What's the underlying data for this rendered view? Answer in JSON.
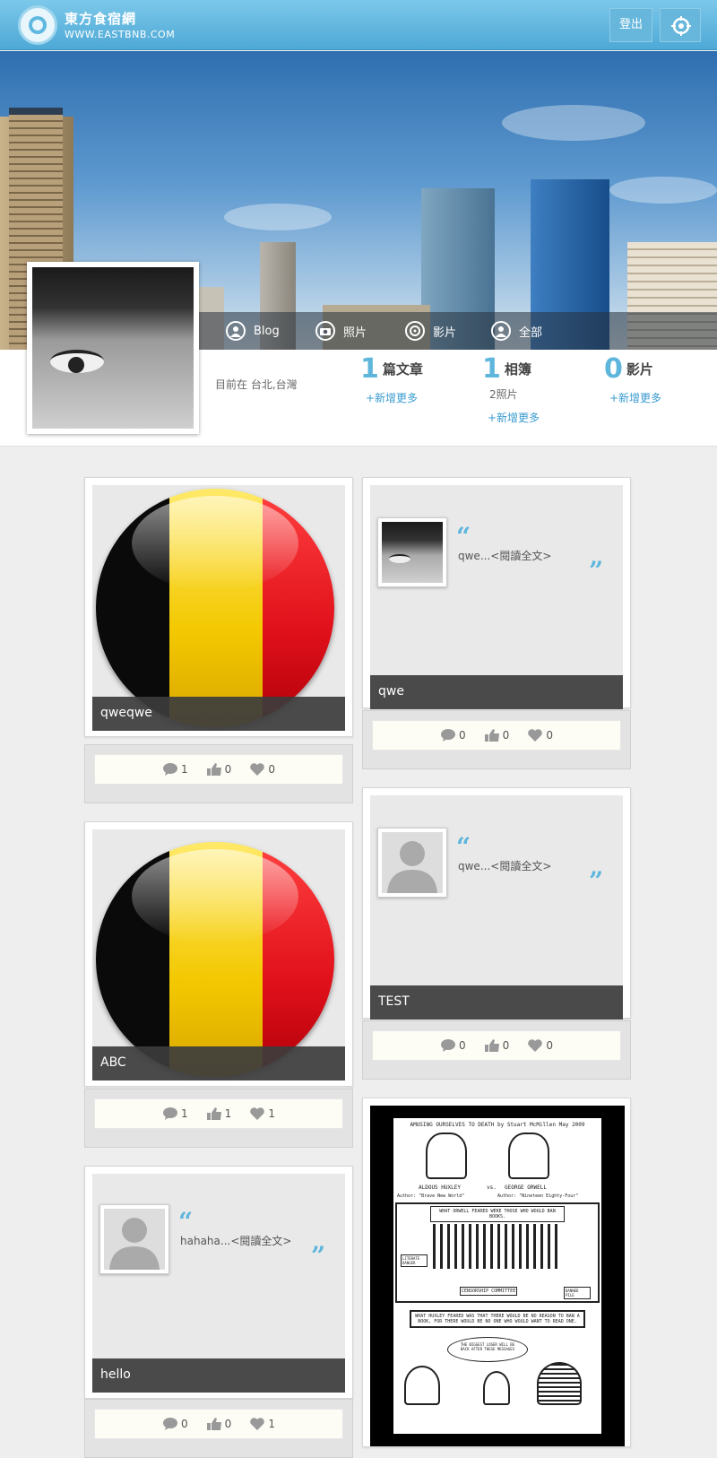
{
  "header": {
    "brand": "東方食宿網",
    "site": "WWW.EASTBNB.COM",
    "logout_label": "登出"
  },
  "nav": [
    {
      "label": "Blog",
      "icon": "user-icon"
    },
    {
      "label": "照片",
      "icon": "camera-icon"
    },
    {
      "label": "影片",
      "icon": "film-icon"
    },
    {
      "label": "全部",
      "icon": "user-icon"
    }
  ],
  "profile": {
    "location": "目前在 台北,台灣"
  },
  "stats": [
    {
      "num": "1",
      "label": "篇文章",
      "sub": "",
      "add": "+新增更多"
    },
    {
      "num": "1",
      "label": "相簿",
      "sub": "2照片",
      "add": "+新增更多"
    },
    {
      "num": "0",
      "label": "影片",
      "sub": "",
      "add": "+新增更多"
    }
  ],
  "left_cards": [
    {
      "title": "qweqwe",
      "comments": "1",
      "likes": "0",
      "favs": "0"
    },
    {
      "title": "ABC",
      "comments": "1",
      "likes": "1",
      "favs": "1"
    },
    {
      "title": "hello",
      "quote": "hahaha...<閱讀全文>",
      "comments": "0",
      "likes": "0",
      "favs": "1"
    }
  ],
  "right_cards": [
    {
      "title": "qwe",
      "quote": "qwe...<閱讀全文>",
      "comments": "0",
      "likes": "0",
      "favs": "0"
    },
    {
      "title": "TEST",
      "quote": "qwe...<閱讀全文>",
      "comments": "0",
      "likes": "0",
      "favs": "0"
    }
  ],
  "comic": {
    "heading": "AMUSING OURSELVES TO DEATH by Stuart McMillen    May 2009",
    "name_left": "ALDOUS HUXLEY",
    "vs": "vs.",
    "name_right": "GEORGE ORWELL",
    "author_left": "Author: \"Brave New World\"",
    "author_right": "Author: \"Nineteen Eighty-Four\"",
    "panel1": "WHAT ORWELL FEARED WERE THOSE WHO WOULD BAN BOOKS.",
    "label_censor": "CENSORSHIP COMMITTEE",
    "label_banned": "BANNED PILE",
    "label_literate": "LITERATE DANGER",
    "panel2": "WHAT HUXLEY FEARED WAS THAT THERE WOULD BE NO REASON TO BAN A BOOK, FOR THERE WOULD BE NO ONE WHO WOULD WANT TO READ ONE.",
    "bubble": "THE BIGGEST LOSER WILL BE BACK AFTER THESE MESSAGES"
  },
  "quote_marks": {
    "open": "“",
    "close": "”"
  }
}
